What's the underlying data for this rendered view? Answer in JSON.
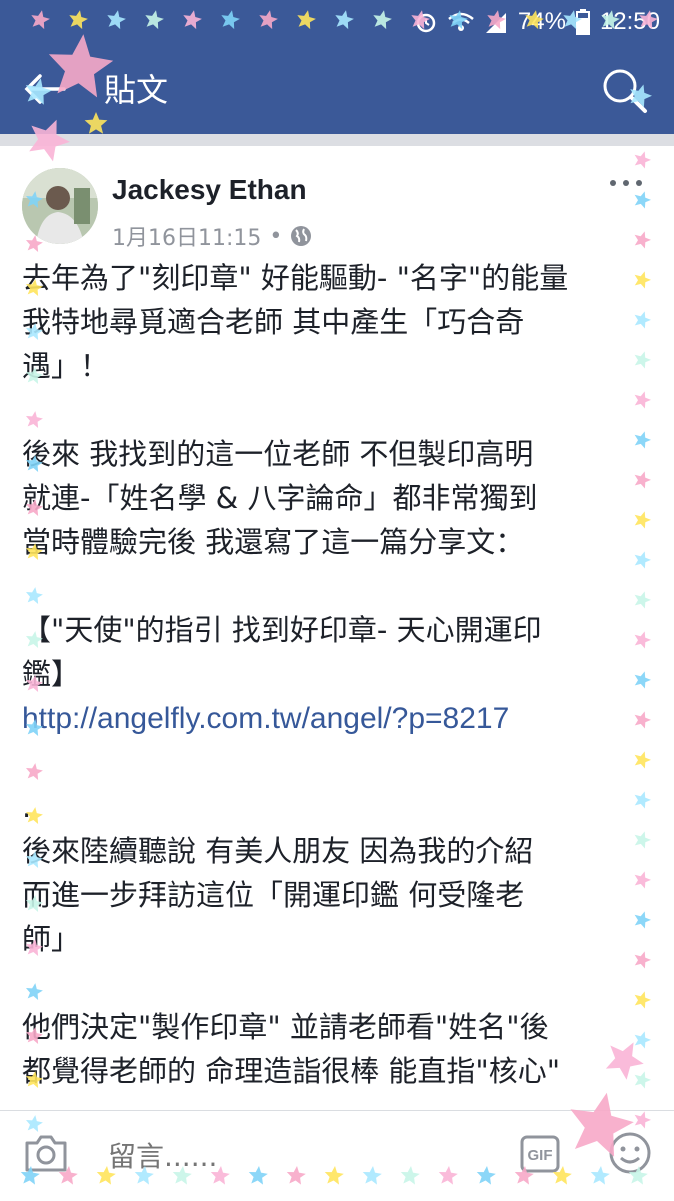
{
  "status_bar": {
    "battery": "74%",
    "time": "12:50"
  },
  "header": {
    "title": "貼文"
  },
  "post": {
    "author": "Jackesy Ethan",
    "timestamp": "1月16日11:15",
    "separator": "•",
    "privacy_icon": "globe-icon",
    "lines": [
      "去年為了\"刻印章\" 好能驅動- \"名字\"的能量",
      "我特地尋覓適合老師 其中產生「巧合奇",
      "遇」！",
      "",
      "後來 我找到的這一位老師 不但製印高明",
      "就連-「姓名學 & 八字論命」都非常獨到",
      "當時體驗完後 我還寫了這一篇分享文：",
      "",
      "【\"天使\"的指引 找到好印章- 天心開運印",
      "鑑】"
    ],
    "link": "http://angelfly.com.tw/angel/?p=8217",
    "lines_after": [
      "",
      ".",
      "後來陸續聽說 有美人朋友 因為我的介紹",
      "而進一步拜訪這位「開運印鑑 何受隆老",
      "師」",
      "",
      "他們決定\"製作印章\" 並請老師看\"姓名\"後",
      "都覺得老師的 命理造詣很棒 能直指\"核心\""
    ]
  },
  "comment_bar": {
    "placeholder": "留言......",
    "gif_label": "GIF"
  },
  "colors": {
    "brand": "#3b5998",
    "link": "#365899",
    "text": "#1d2129",
    "muted": "#90949c"
  }
}
